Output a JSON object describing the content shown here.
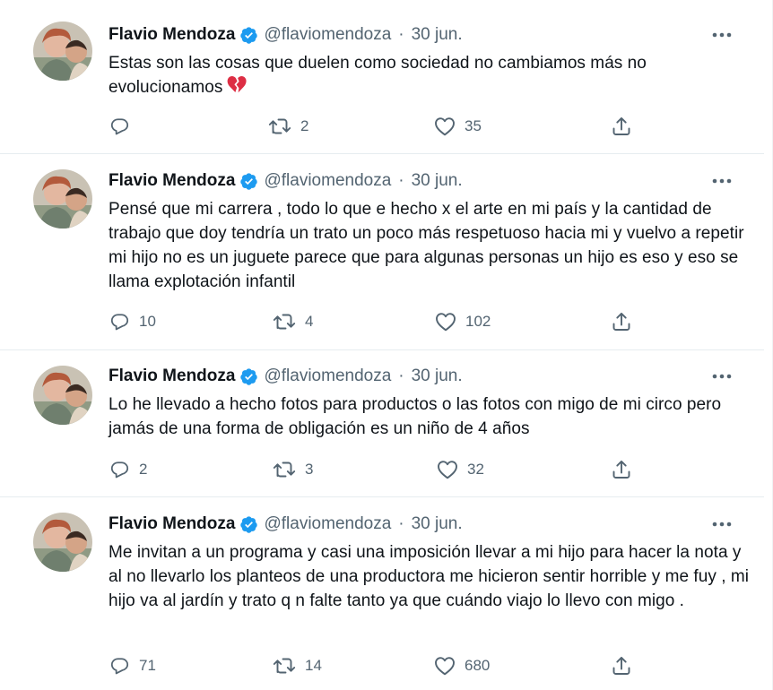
{
  "tweets": [
    {
      "author": "Flavio Mendoza",
      "handle": "@flaviomendoza",
      "separator": "·",
      "date": "30 jun.",
      "text": "Estas son las cosas que duelen como sociedad no cambiamos más no evolucionamos",
      "emoji": "broken-heart-icon",
      "replies": "",
      "retweets": "2",
      "likes": "35"
    },
    {
      "author": "Flavio Mendoza",
      "handle": "@flaviomendoza",
      "separator": "·",
      "date": "30 jun.",
      "text": "Pensé que mi carrera , todo lo que e hecho x el arte en mi país y la cantidad de trabajo que doy tendría un trato un poco más respetuoso hacia mi y vuelvo a repetir mi hijo no es un juguete parece que para algunas personas un hijo es eso y eso se llama explotación infantil",
      "replies": "10",
      "retweets": "4",
      "likes": "102"
    },
    {
      "author": "Flavio Mendoza",
      "handle": "@flaviomendoza",
      "separator": "·",
      "date": "30 jun.",
      "text": "Lo he llevado a hecho fotos para productos o las fotos con migo de mi circo pero jamás de una forma de obligación es un niño de 4 años",
      "replies": "2",
      "retweets": "3",
      "likes": "32"
    },
    {
      "author": "Flavio Mendoza",
      "handle": "@flaviomendoza",
      "separator": "·",
      "date": "30 jun.",
      "text": "Me invitan a un programa y casi una imposición llevar a mi hijo para hacer la nota y al no llevarlo los planteos de una productora me hicieron sentir horrible y me fuy , mi hijo va al jardín y trato q n falte tanto ya que cuándo viajo lo llevo con migo .",
      "replies": "71",
      "retweets": "14",
      "likes": "680"
    }
  ],
  "colors": {
    "accent": "#1d9bf0",
    "secondary_text": "#536471",
    "primary_text": "#0f1419",
    "divider": "#e6ecf0",
    "broken_heart": "#e0245e"
  },
  "icons": {
    "verified": "verified-badge-icon",
    "more": "more-options-icon",
    "reply": "reply-icon",
    "retweet": "retweet-icon",
    "like": "like-icon",
    "share": "share-icon"
  }
}
